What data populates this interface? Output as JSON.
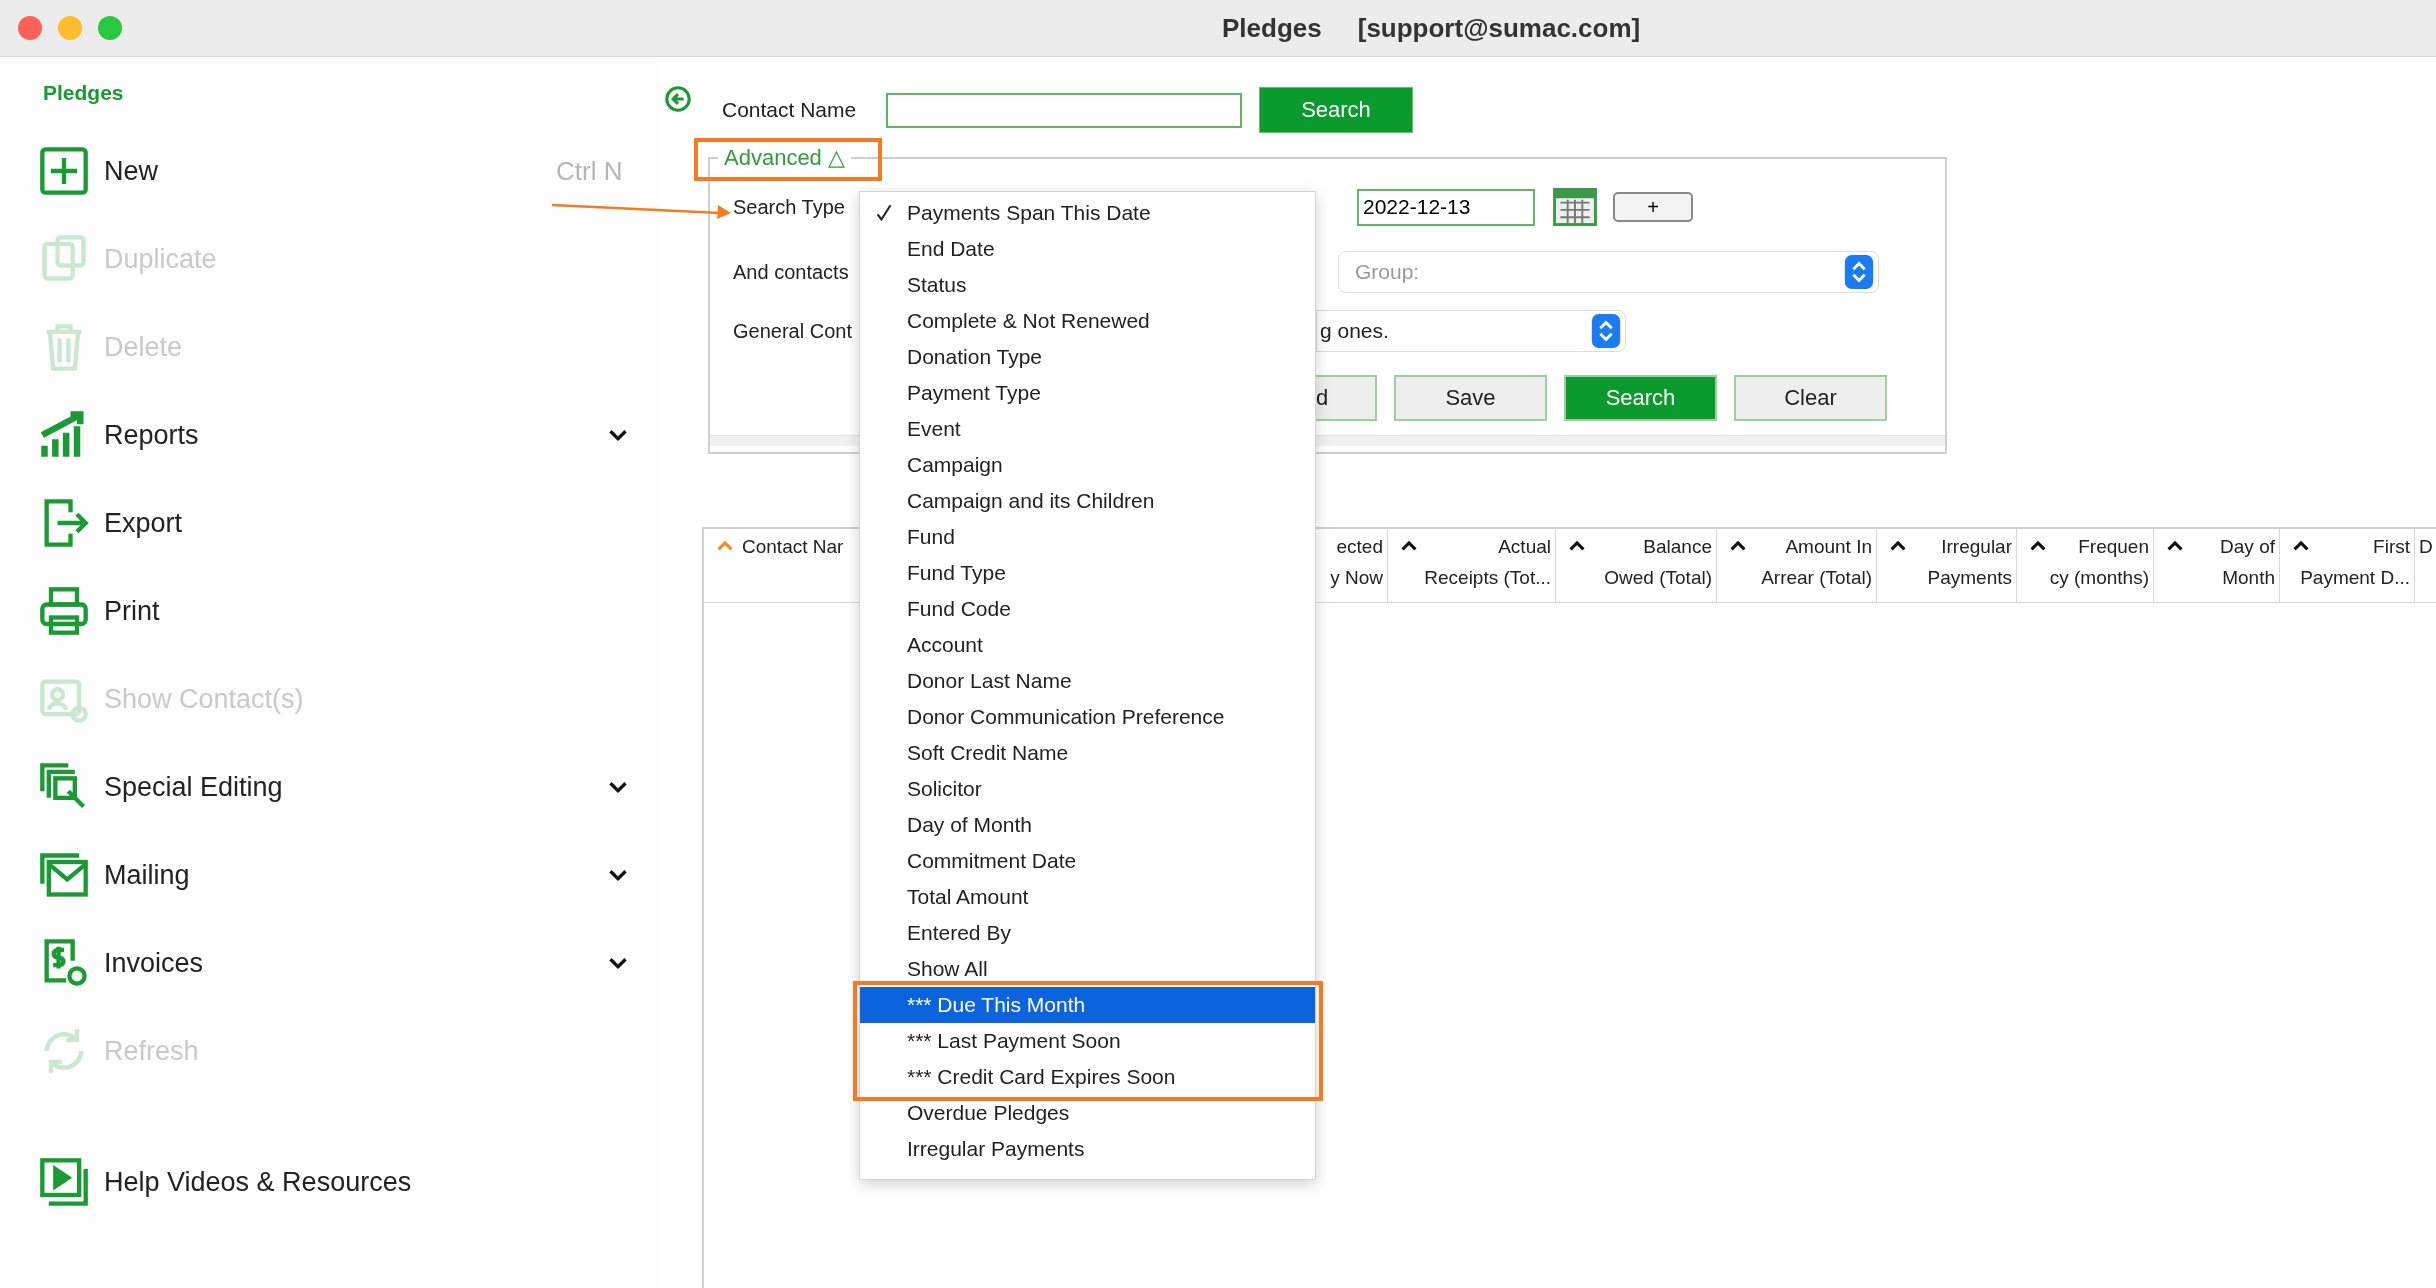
{
  "window": {
    "title": "Pledges",
    "user": "[support@sumac.com]"
  },
  "sidebar": {
    "heading": "Pledges",
    "items": [
      {
        "label": "New",
        "kind": "plus",
        "disabled": false,
        "expandable": false,
        "shortcut": "Ctrl N"
      },
      {
        "label": "Duplicate",
        "kind": "duplicate",
        "disabled": true,
        "expandable": false
      },
      {
        "label": "Delete",
        "kind": "trash",
        "disabled": true,
        "expandable": false
      },
      {
        "label": "Reports",
        "kind": "chart",
        "disabled": false,
        "expandable": true
      },
      {
        "label": "Export",
        "kind": "export",
        "disabled": false,
        "expandable": false
      },
      {
        "label": "Print",
        "kind": "printer",
        "disabled": false,
        "expandable": false
      },
      {
        "label": "Show Contact(s)",
        "kind": "contact",
        "disabled": true,
        "expandable": false
      },
      {
        "label": "Special Editing",
        "kind": "editing",
        "disabled": false,
        "expandable": true
      },
      {
        "label": "Mailing",
        "kind": "mail",
        "disabled": false,
        "expandable": true
      },
      {
        "label": "Invoices",
        "kind": "invoice",
        "disabled": false,
        "expandable": true
      },
      {
        "label": "Refresh",
        "kind": "refresh",
        "disabled": true,
        "expandable": false
      }
    ],
    "footer_item": {
      "label": "Help Videos & Resources",
      "kind": "video",
      "disabled": false
    }
  },
  "search": {
    "label": "Contact Name",
    "button": "Search"
  },
  "advanced": {
    "legend": "Advanced △",
    "search_type_label": "Search Type",
    "date": "2022-12-13",
    "add_button": "+",
    "group_label": "And contacts",
    "group_placeholder": "Group:",
    "control_label": "General Cont",
    "control_value": "g ones.",
    "buttons": [
      {
        "label": "d",
        "primary": false
      },
      {
        "label": "Save",
        "primary": false
      },
      {
        "label": "Search",
        "primary": true
      },
      {
        "label": "Clear",
        "primary": false
      }
    ]
  },
  "dropdown": {
    "items": [
      {
        "label": "Payments Span This Date",
        "checked": true,
        "selected": false
      },
      {
        "label": "End Date",
        "checked": false,
        "selected": false
      },
      {
        "label": "Status",
        "checked": false,
        "selected": false
      },
      {
        "label": "Complete & Not Renewed",
        "checked": false,
        "selected": false
      },
      {
        "label": "Donation Type",
        "checked": false,
        "selected": false
      },
      {
        "label": "Payment Type",
        "checked": false,
        "selected": false
      },
      {
        "label": "Event",
        "checked": false,
        "selected": false
      },
      {
        "label": "Campaign",
        "checked": false,
        "selected": false
      },
      {
        "label": "Campaign and its Children",
        "checked": false,
        "selected": false
      },
      {
        "label": "Fund",
        "checked": false,
        "selected": false
      },
      {
        "label": "Fund Type",
        "checked": false,
        "selected": false
      },
      {
        "label": "Fund Code",
        "checked": false,
        "selected": false
      },
      {
        "label": "Account",
        "checked": false,
        "selected": false
      },
      {
        "label": "Donor Last Name",
        "checked": false,
        "selected": false
      },
      {
        "label": "Donor Communication Preference",
        "checked": false,
        "selected": false
      },
      {
        "label": "Soft Credit Name",
        "checked": false,
        "selected": false
      },
      {
        "label": "Solicitor",
        "checked": false,
        "selected": false
      },
      {
        "label": "Day of Month",
        "checked": false,
        "selected": false
      },
      {
        "label": "Commitment Date",
        "checked": false,
        "selected": false
      },
      {
        "label": "Total Amount",
        "checked": false,
        "selected": false
      },
      {
        "label": "Entered By",
        "checked": false,
        "selected": false
      },
      {
        "label": "Show All",
        "checked": false,
        "selected": false
      },
      {
        "label": "*** Due This Month",
        "checked": false,
        "selected": true
      },
      {
        "label": "*** Last Payment Soon",
        "checked": false,
        "selected": false
      },
      {
        "label": "*** Credit Card Expires Soon",
        "checked": false,
        "selected": false
      },
      {
        "label": "Overdue Pledges",
        "checked": false,
        "selected": false
      },
      {
        "label": "Irregular Payments",
        "checked": false,
        "selected": false
      }
    ]
  },
  "table": {
    "columns": [
      {
        "lines": [
          "Contact Nar"
        ],
        "caret": true,
        "sorted": true
      },
      {
        "lines": [
          "ected",
          "y Now"
        ],
        "caret": false
      },
      {
        "lines": [
          "Actual",
          "Receipts (Tot..."
        ],
        "caret": true,
        "sorted": false
      },
      {
        "lines": [
          "Balance",
          "Owed (Total)"
        ],
        "caret": true,
        "sorted": false
      },
      {
        "lines": [
          "Amount In",
          "Arrear (Total)"
        ],
        "caret": true,
        "sorted": false
      },
      {
        "lines": [
          "Irregular",
          "Payments"
        ],
        "caret": true,
        "sorted": false
      },
      {
        "lines": [
          "Frequen",
          "cy (months)"
        ],
        "caret": true,
        "sorted": false
      },
      {
        "lines": [
          "Day of",
          "Month"
        ],
        "caret": true,
        "sorted": false
      },
      {
        "lines": [
          "First",
          "Payment D..."
        ],
        "caret": true,
        "sorted": false
      },
      {
        "lines": [
          "D"
        ],
        "caret": false
      }
    ]
  }
}
